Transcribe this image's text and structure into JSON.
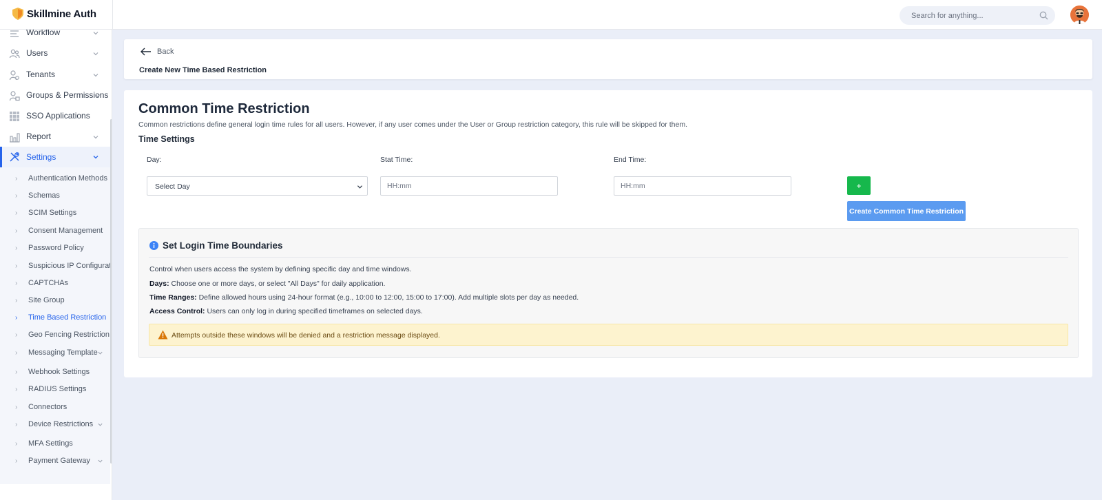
{
  "app": {
    "brand": "Skillmine Auth"
  },
  "search": {
    "placeholder": "Search for anything..."
  },
  "sidebar": {
    "items": [
      {
        "label": "Workflow",
        "icon": "workflow-icon"
      },
      {
        "label": "Users",
        "icon": "users-icon"
      },
      {
        "label": "Tenants",
        "icon": "tenants-icon"
      },
      {
        "label": "Groups & Permissions",
        "icon": "groups-icon"
      },
      {
        "label": "SSO Applications",
        "icon": "grid-icon"
      },
      {
        "label": "Report",
        "icon": "report-icon"
      },
      {
        "label": "Settings",
        "icon": "settings-icon"
      }
    ],
    "sub_items": [
      "Authentication Methods",
      "Schemas",
      "SCIM Settings",
      "Consent Management",
      "Password Policy",
      "Suspicious IP Configuration",
      "CAPTCHAs",
      "Site Group",
      "Time Based Restriction",
      "Geo Fencing Restriction",
      "Messaging Template",
      "Webhook Settings",
      "RADIUS Settings",
      "Connectors",
      "Device Restrictions",
      "MFA Settings",
      "Payment Gateway"
    ],
    "active_sub_item": "Time Based Restriction"
  },
  "header": {
    "back_label": "Back",
    "page_title": "Create New Time Based Restriction"
  },
  "form": {
    "section_title": "Common Time Restriction",
    "section_description": "Common restrictions define general login time rules for all users. However, if any user comes under the User or Group restriction category, this rule will be skipped for them.",
    "settings_title": "Time Settings",
    "day_label": "Day:",
    "day_value": "Select Day",
    "start_label": "Stat Time:",
    "start_placeholder": "HH:mm",
    "end_label": "End Time:",
    "end_placeholder": "HH:mm",
    "add_label": "+",
    "create_label": "Create Common Time Restriction"
  },
  "info": {
    "title": "Set Login Time Boundaries",
    "intro": "Control when users access the system by defining specific day and time windows.",
    "days_term": "Days:",
    "days_text": " Choose one or more days, or select \"All Days\" for daily application.",
    "ranges_term": "Time Ranges:",
    "ranges_text": " Define allowed hours using 24-hour format (e.g., 10:00 to 12:00, 15:00 to 17:00). Add multiple slots per day as needed.",
    "access_term": "Access Control:",
    "access_text": " Users can only log in during specified timeframes on selected days.",
    "warning": "Attempts outside these windows will be denied and a restriction message displayed."
  },
  "colors": {
    "accent": "#2563eb",
    "add_button": "#16b84c",
    "create_button": "#5b9bf0",
    "warning_bg": "#fdf3cf"
  }
}
